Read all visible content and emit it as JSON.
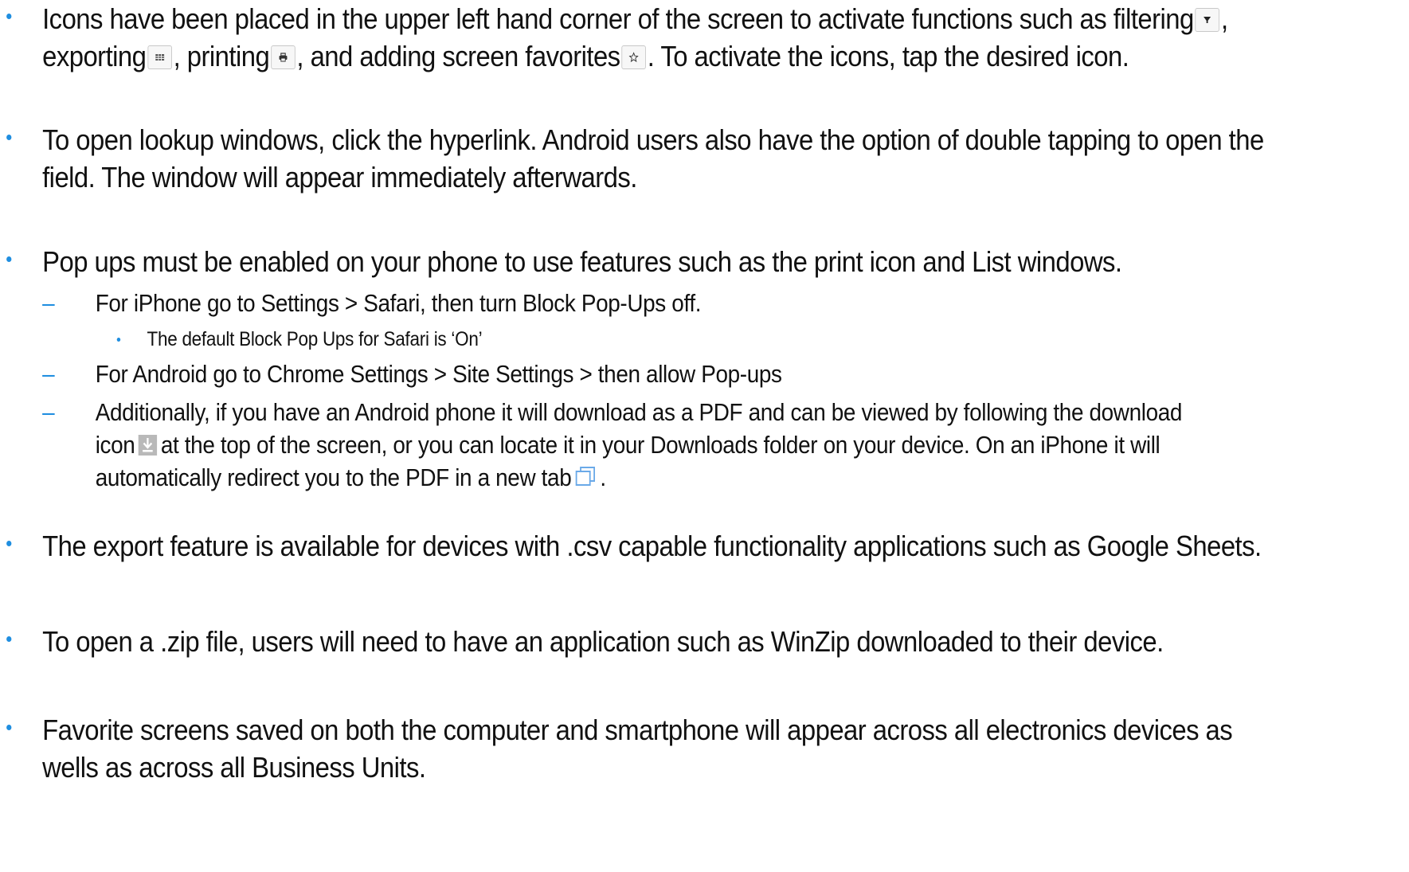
{
  "bullets": {
    "icons": {
      "line1_a": "Icons have been placed in the upper left hand corner of the screen to activate functions such as filtering",
      "line1_b": ",",
      "line2_a": "exporting",
      "line2_b": ", printing",
      "line2_c": ", and adding screen favorites",
      "line2_d": ". To activate the icons, tap the desired icon.",
      "icon_names": [
        "filter-icon",
        "export-grid-icon",
        "print-icon",
        "star-favorite-icon"
      ]
    },
    "lookup": {
      "line1": "To open lookup windows, click the hyperlink. Android users also have the option of double tapping to open the",
      "line2": "field. The window will appear immediately afterwards."
    },
    "popups": {
      "line1": "Pop ups must be enabled on your phone to use features such as the print icon and List windows.",
      "dash": "–",
      "iphone": "For iPhone go to Settings > Safari, then turn Block Pop-Ups off.",
      "iphone_default": "The default Block Pop Ups for Safari is ‘On’",
      "android": "For Android go to Chrome Settings > Site Settings > then allow Pop-ups",
      "additional_1": "Additionally, if you have an Android phone it will download as a PDF and can be viewed by following the download",
      "additional_2a": "icon",
      "additional_2b": "at the top of the screen, or you can locate it in your Downloads folder on your device. On an iPhone it will",
      "additional_3a": "automatically redirect you to the PDF in a new tab",
      "additional_3b": ".",
      "icon_names": [
        "download-icon",
        "new-tab-icon"
      ]
    },
    "export": {
      "line1": "The export feature is available for devices with .csv capable functionality applications such as Google Sheets."
    },
    "zip": {
      "line1": "To open a .zip file, users will need to have an application such as WinZip downloaded to their device."
    },
    "favorites": {
      "line1": "Favorite screens saved on both the computer and smartphone will appear across all electronics devices as",
      "line2": "wells as across all Business Units."
    }
  },
  "colors": {
    "bullet": "#1f8ee0",
    "text": "#111111",
    "icon_border": "#c8c8c8"
  }
}
